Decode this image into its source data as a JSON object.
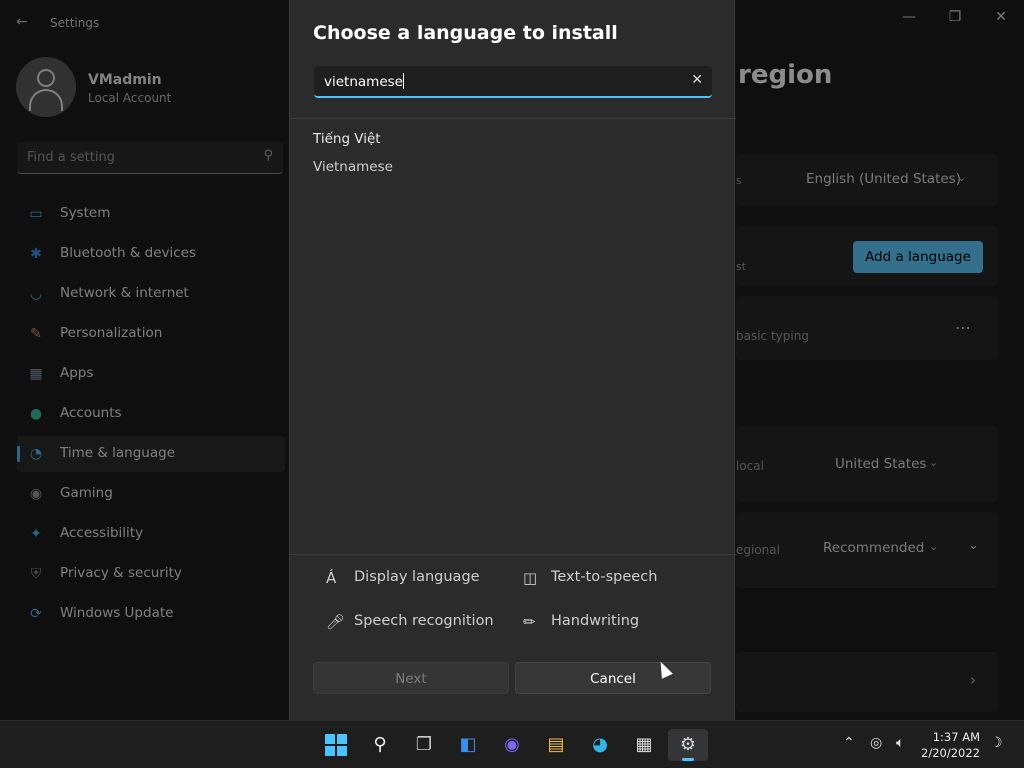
{
  "window": {
    "title": "Settings",
    "controls": {
      "minimize": "—",
      "maximize": "❐",
      "close": "✕"
    }
  },
  "profile": {
    "name": "VMadmin",
    "account_type": "Local Account"
  },
  "search": {
    "placeholder": "Find a setting"
  },
  "sidebar": {
    "items": [
      {
        "label": "System",
        "icon": "monitor-icon",
        "color": "#4cc2ff"
      },
      {
        "label": "Bluetooth & devices",
        "icon": "bluetooth-icon",
        "color": "#3b8eea"
      },
      {
        "label": "Network & internet",
        "icon": "wifi-icon",
        "color": "#4cc2ff"
      },
      {
        "label": "Personalization",
        "icon": "brush-icon",
        "color": "#e39c5a"
      },
      {
        "label": "Apps",
        "icon": "apps-icon",
        "color": "#8aa0b8"
      },
      {
        "label": "Accounts",
        "icon": "person-icon",
        "color": "#38c0a0"
      },
      {
        "label": "Time & language",
        "icon": "globe-clock-icon",
        "color": "#4cc2ff",
        "selected": true
      },
      {
        "label": "Gaming",
        "icon": "gamepad-icon",
        "color": "#9aa0a6"
      },
      {
        "label": "Accessibility",
        "icon": "accessibility-icon",
        "color": "#4cc2ff"
      },
      {
        "label": "Privacy & security",
        "icon": "shield-icon",
        "color": "#8d8d8d"
      },
      {
        "label": "Windows Update",
        "icon": "update-icon",
        "color": "#4cc2ff"
      }
    ]
  },
  "background_page": {
    "title_fragment": "region",
    "display_language_fragment": "s",
    "display_language_value": "English (United States)",
    "add_language_button": "Add a language",
    "preferred_fragment": "st",
    "language_row_fragment": "basic typing",
    "country_fragment": "local",
    "country_value": "United States",
    "format_fragment": "egional",
    "format_value": "Recommended"
  },
  "dialog": {
    "title": "Choose a language to install",
    "search_value": "vietnamese",
    "results": [
      {
        "native_name": "Tiếng Việt",
        "english_name": "Vietnamese"
      }
    ],
    "features": [
      {
        "label": "Display language",
        "icon": "display-language-icon"
      },
      {
        "label": "Text-to-speech",
        "icon": "text-to-speech-icon"
      },
      {
        "label": "Speech recognition",
        "icon": "microphone-icon"
      },
      {
        "label": "Handwriting",
        "icon": "handwriting-icon"
      }
    ],
    "next_label": "Next",
    "cancel_label": "Cancel"
  },
  "taskbar": {
    "time": "1:37 AM",
    "date": "2/20/2022"
  }
}
